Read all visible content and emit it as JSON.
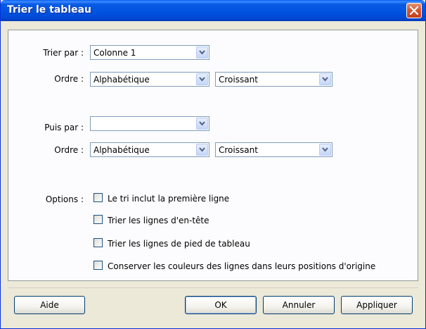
{
  "window": {
    "title": "Trier le tableau"
  },
  "sort1": {
    "label": "Trier par :",
    "column": "Colonne 1",
    "order_label": "Ordre :",
    "type": "Alphabétique",
    "direction": "Croissant"
  },
  "sort2": {
    "label": "Puis par :",
    "column": "",
    "order_label": "Ordre :",
    "type": "Alphabétique",
    "direction": "Croissant"
  },
  "options": {
    "label": "Options :",
    "items": [
      {
        "label": "Le tri inclut la première ligne",
        "checked": false
      },
      {
        "label": "Trier les lignes d'en-tête",
        "checked": false
      },
      {
        "label": "Trier les lignes de pied de tableau",
        "checked": false
      },
      {
        "label": "Conserver les couleurs des lignes dans leurs positions d'origine",
        "checked": false
      }
    ]
  },
  "buttons": {
    "help": "Aide",
    "ok": "OK",
    "cancel": "Annuler",
    "apply": "Appliquer"
  }
}
